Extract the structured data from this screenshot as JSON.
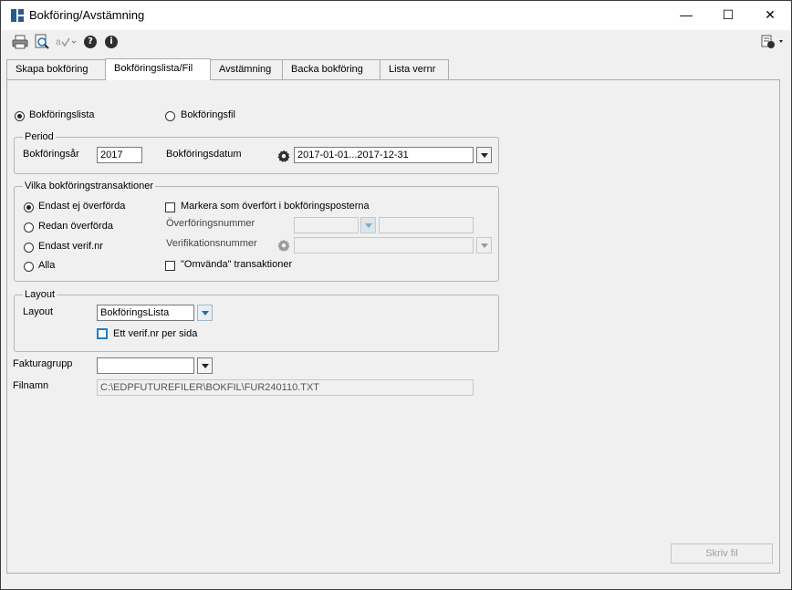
{
  "window": {
    "title": "Bokföring/Avstämning",
    "controls": {
      "minimize": "—",
      "maximize": "☐",
      "close": "✕"
    }
  },
  "toolbar": {
    "icons": [
      "printer-icon",
      "print-preview-icon",
      "spellcheck-icon",
      "help-icon",
      "info-icon",
      "options-menu-icon"
    ],
    "help_glyph": "?",
    "info_glyph": "i"
  },
  "tabs": [
    {
      "label": "Skapa bokföring",
      "active": false
    },
    {
      "label": "Bokföringslista/Fil",
      "active": true
    },
    {
      "label": "Avstämning",
      "active": false
    },
    {
      "label": "Backa bokföring",
      "active": false
    },
    {
      "label": "Lista vernr",
      "active": false
    }
  ],
  "output_type": {
    "option_list": "Bokföringslista",
    "option_file": "Bokföringsfil",
    "selected": "Bokföringslista"
  },
  "period": {
    "legend": "Period",
    "year_label": "Bokföringsår",
    "year_value": "2017",
    "date_label": "Bokföringsdatum",
    "date_value": "2017-01-01...2017-12-31"
  },
  "transactions": {
    "legend": "Vilka bokföringstransaktioner",
    "options": [
      "Endast ej överförda",
      "Redan överförda",
      "Endast verif.nr",
      "Alla"
    ],
    "selected": "Endast ej överförda",
    "mark_transferred_label": "Markera som överfört i bokföringsposterna",
    "transfer_number_label": "Överföringsnummer",
    "transfer_number_value": "",
    "transfer_number_to": "",
    "verification_number_label": "Verifikationsnummer",
    "verification_number_value": "",
    "reversed_label": "\"Omvända\" transaktioner"
  },
  "layout": {
    "legend": "Layout",
    "layout_label": "Layout",
    "layout_value": "BokföringsLista",
    "one_per_page_label": "Ett verif.nr per sida"
  },
  "invoice_group": {
    "label": "Fakturagrupp",
    "value": ""
  },
  "filename": {
    "label": "Filnamn",
    "value": "C:\\EDPFUTUREFILER\\BOKFIL\\FUR240110.TXT"
  },
  "write_file_button": "Skriv fil",
  "colors": {
    "accent": "#1f7fc9",
    "icon_dark": "#2e2e2e",
    "disabled_text": "#a0a0a0"
  }
}
